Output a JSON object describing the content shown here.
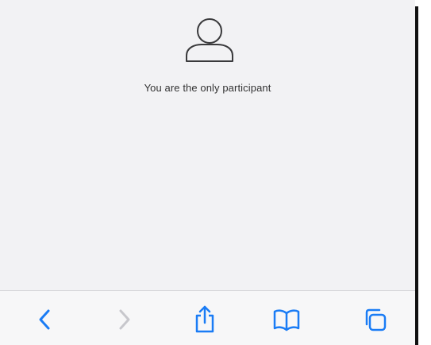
{
  "participants": {
    "message": "You are the only participant",
    "avatar_icon": "person-outline-icon"
  },
  "toolbar": {
    "back_icon": "chevron-left-icon",
    "forward_icon": "chevron-right-icon",
    "share_icon": "share-icon",
    "bookmarks_icon": "book-icon",
    "tabs_icon": "tabs-icon",
    "active_color": "#1a7cf5",
    "disabled_color": "#c7c7cc"
  }
}
